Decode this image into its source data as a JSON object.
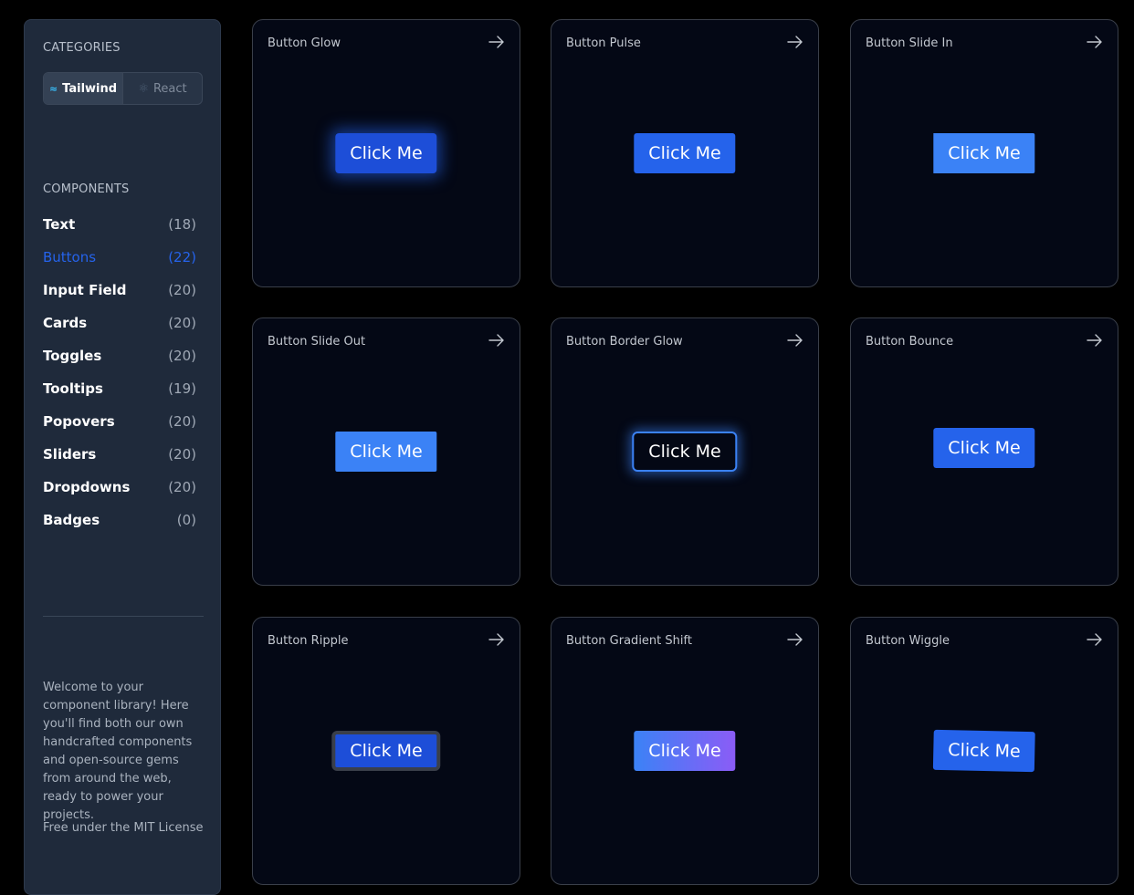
{
  "sidebar": {
    "categories_title": "CATEGORIES",
    "tabs": [
      {
        "label": "Tailwind",
        "icon": "tailwind-icon",
        "active": true
      },
      {
        "label": "React",
        "icon": "react-icon",
        "active": false
      }
    ],
    "components_title": "COMPONENTS",
    "items": [
      {
        "label": "Text",
        "count": "(18)"
      },
      {
        "label": "Buttons",
        "count": "(22)",
        "active": true
      },
      {
        "label": "Input Field",
        "count": "(20)"
      },
      {
        "label": "Cards",
        "count": "(20)"
      },
      {
        "label": "Toggles",
        "count": "(20)"
      },
      {
        "label": "Tooltips",
        "count": "(19)"
      },
      {
        "label": "Popovers",
        "count": "(20)"
      },
      {
        "label": "Sliders",
        "count": "(20)"
      },
      {
        "label": "Dropdowns",
        "count": "(20)"
      },
      {
        "label": "Badges",
        "count": "(0)"
      }
    ],
    "about": "Welcome to your component library! Here you'll find both our own handcrafted components and open-source gems from around the web, ready to power your projects.",
    "license": "Free under the MIT License"
  },
  "cards": [
    {
      "title": "Button Glow",
      "button": "Click Me"
    },
    {
      "title": "Button Pulse",
      "button": "Click Me"
    },
    {
      "title": "Button Slide In",
      "button": "Click Me"
    },
    {
      "title": "Button Slide Out",
      "button": "Click Me"
    },
    {
      "title": "Button Border Glow",
      "button": "Click Me"
    },
    {
      "title": "Button Bounce",
      "button": "Click Me"
    },
    {
      "title": "Button Ripple",
      "button": "Click Me"
    },
    {
      "title": "Button Gradient Shift",
      "button": "Click Me"
    },
    {
      "title": "Button Wiggle",
      "button": "Click Me"
    }
  ],
  "colors": {
    "accent": "#2563eb",
    "background": "#000000",
    "sidebar": "#1f2a3b",
    "card": "#040815"
  }
}
